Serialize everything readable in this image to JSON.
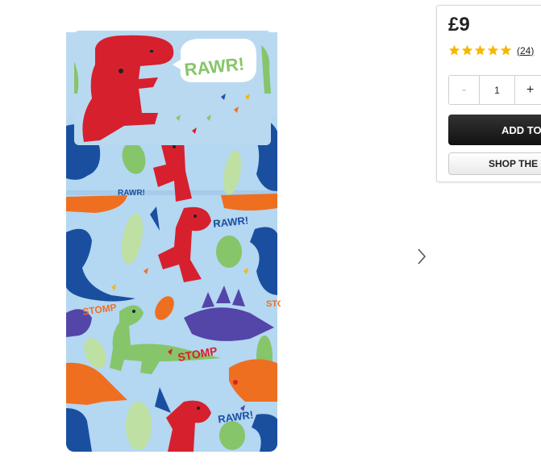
{
  "product": {
    "image_alt": "Dinosaur print duvet cover and pillowcase set",
    "print_words": {
      "rawr_pillow": "RAWR!",
      "rawr_small": "RAWR!",
      "rawr_bottom": "RAWR!",
      "rawr_fold": "RAWR!",
      "stomp_left": "STOMP",
      "stomp_mid": "STOMP",
      "stomp_right": "STO"
    }
  },
  "gallery": {
    "next_icon": "chevron-right-icon"
  },
  "buy_panel": {
    "price": "£9",
    "rating": {
      "stars": 5,
      "count": "24",
      "open_paren": "(",
      "close_paren": ")"
    },
    "quantity": {
      "minus": "-",
      "value": "1",
      "plus": "+"
    },
    "add_button": "ADD TO BASKET",
    "shop_button": "SHOP THE RANGE"
  },
  "colors": {
    "star": "#f5b800",
    "duvet_blue": "#b4d7f2",
    "dino_red": "#d7202d",
    "dino_navy": "#1a4fa0",
    "dino_green": "#86c56a",
    "dino_orange": "#ef6f21",
    "dino_purple": "#5346a8"
  }
}
